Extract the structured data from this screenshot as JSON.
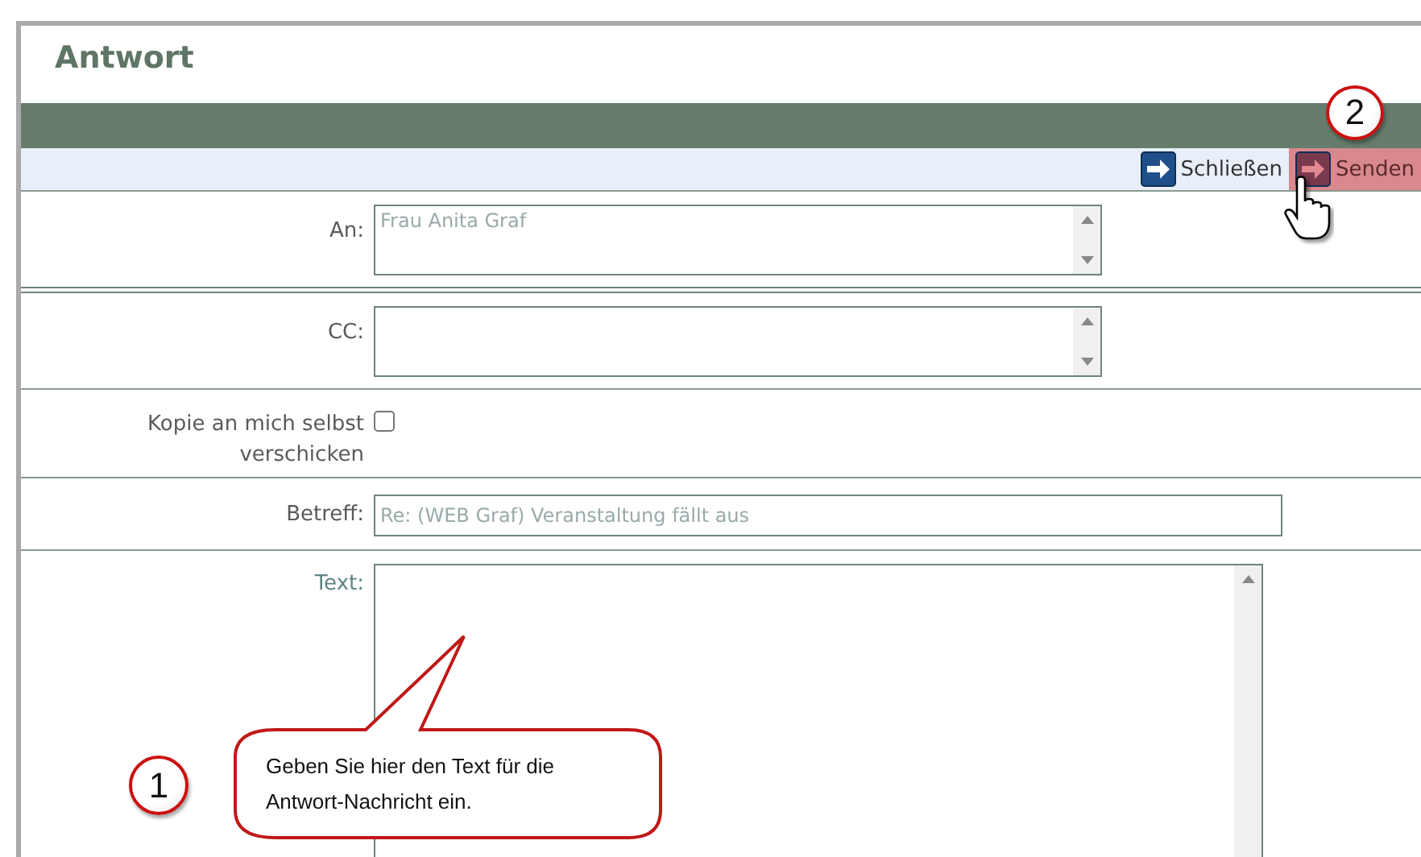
{
  "window": {
    "title": "Antwort"
  },
  "toolbar": {
    "buttons": [
      {
        "label": "Schließen",
        "kind": "close",
        "highlighted": false
      },
      {
        "label": "Senden",
        "kind": "send",
        "highlighted": true
      }
    ]
  },
  "fields": [
    {
      "label": "An:",
      "kind": "textarea",
      "value": "Frau Anita Graf"
    },
    {
      "label": "CC:",
      "kind": "textarea"
    },
    {
      "label": "Kopie an mich selbst verschicken",
      "kind": "checkbox",
      "checked": false
    },
    {
      "label": "Betreff:",
      "kind": "input",
      "value": "Re: (WEB Graf) Veranstaltung fällt aus"
    },
    {
      "label": "Text:",
      "kind": "editor"
    }
  ],
  "annotations": [
    {
      "number": "1",
      "text": "Geben Sie hier den Text für die Antwort-Nachricht ein."
    },
    {
      "number": "2"
    }
  ]
}
